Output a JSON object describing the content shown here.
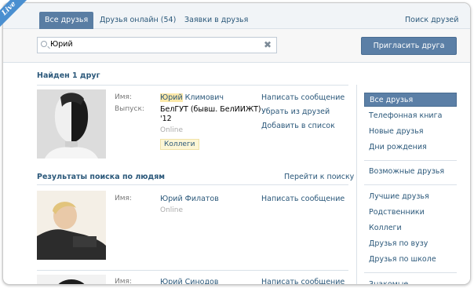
{
  "ribbon": "Live",
  "tabs": [
    {
      "label": "Все друзья"
    },
    {
      "label": "Друзья онлайн (54)"
    },
    {
      "label": "Заявки в друзья"
    }
  ],
  "search_friends_link": "Поиск друзей",
  "search": {
    "value": "Юрий"
  },
  "invite_button": "Пригласить друга",
  "found_title": "Найден 1 друг",
  "found": {
    "label_name": "Имя:",
    "label_grad": "Выпуск:",
    "name_hl": "Юрий",
    "name_rest": " Климович",
    "grad_line1": "БелГУТ (бывш. БелИИЖТ)",
    "grad_line2": "'12",
    "status": "Online",
    "badge": "Коллеги",
    "actions": [
      "Написать сообщение",
      "Убрать из друзей",
      "Добавить в список"
    ]
  },
  "people_title": "Результаты поиска по людям",
  "people_link": "Перейти к поиску",
  "people": [
    {
      "label": "Имя:",
      "name": "Юрий Филатов",
      "status": "Online",
      "action": "Написать сообщение"
    },
    {
      "label": "Имя:",
      "name": "Юрий Синодов",
      "action": "Написать сообщение"
    }
  ],
  "sidebar": {
    "group1": [
      "Все друзья",
      "Телефонная книга",
      "Новые друзья",
      "Дни рождения"
    ],
    "group2": [
      "Возможные друзья"
    ],
    "group3": [
      "Лучшие друзья",
      "Родственники",
      "Коллеги",
      "Друзья по вузу",
      "Друзья по школе"
    ],
    "group4": [
      "Знакомые"
    ]
  },
  "colors": {
    "accent": "#597da3",
    "link": "#2b587a",
    "highlight": "#fde8a8"
  }
}
